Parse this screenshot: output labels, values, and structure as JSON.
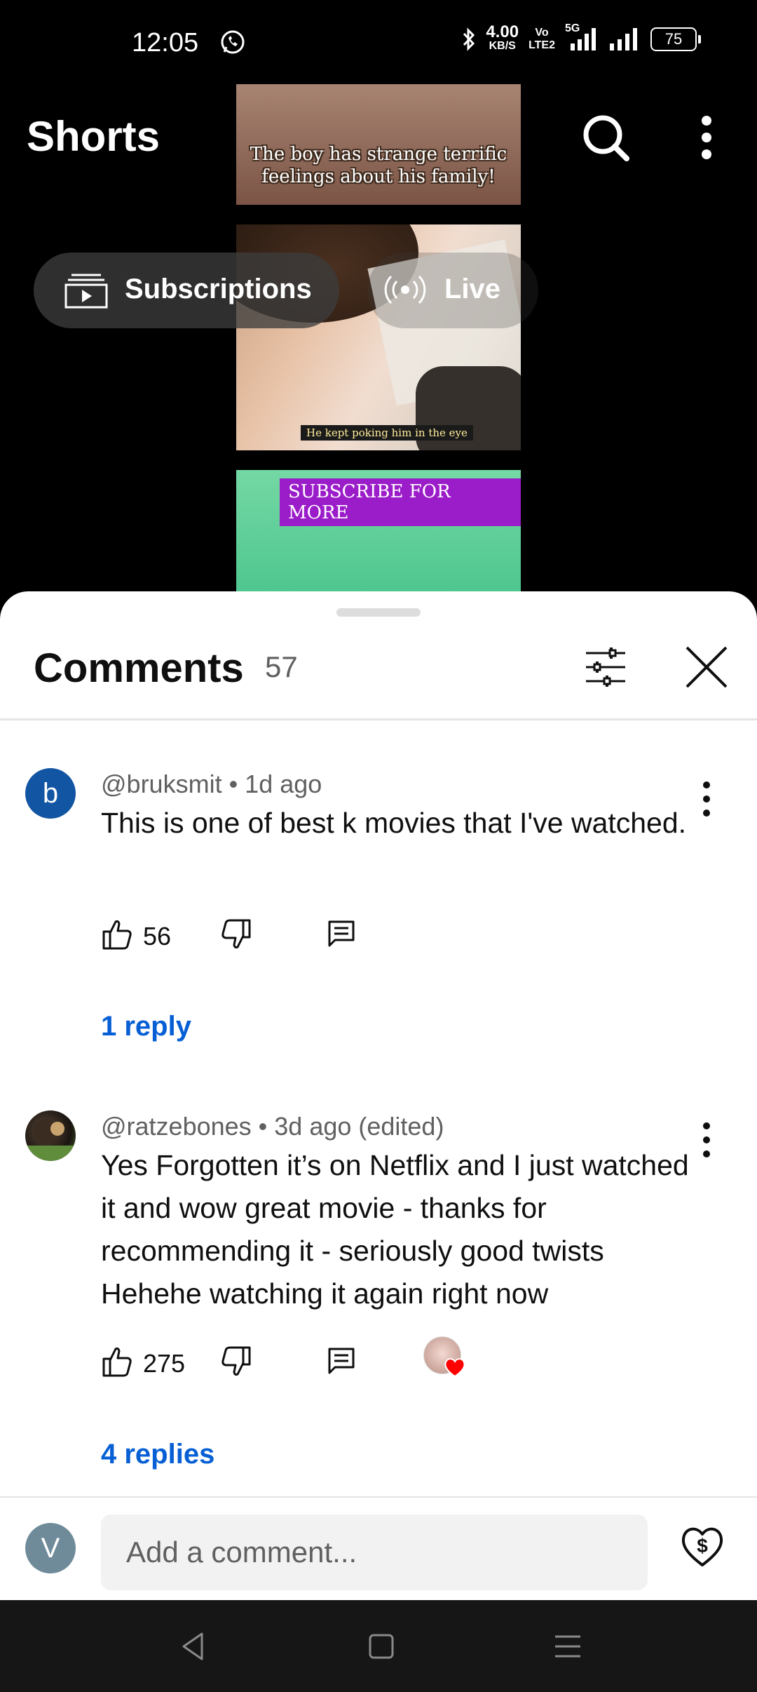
{
  "status_bar": {
    "time": "12:05",
    "net_speed_value": "4.00",
    "net_speed_unit": "KB/S",
    "volte_top": "Vo",
    "volte_bottom": "LTE2",
    "network": "5G",
    "battery": "75"
  },
  "header": {
    "title": "Shorts",
    "chips": [
      {
        "label": "Subscriptions",
        "icon": "subscriptions-icon"
      },
      {
        "label": "Live",
        "icon": "live-icon"
      }
    ]
  },
  "video": {
    "caption_top": "The boy has strange terrific feelings about his family!",
    "caption_mid": "He kept poking him in the eye",
    "caption_bottom": "SUBSCRIBE FOR MORE"
  },
  "comments_panel": {
    "title": "Comments",
    "count": "57",
    "comments": [
      {
        "avatar_letter": "b",
        "author": "@bruksmit",
        "time": "1d ago",
        "meta": "@bruksmit • 1d ago",
        "text": "This is one of best k movies that I've watched.",
        "likes": "56",
        "replies": "1 reply"
      },
      {
        "author": "@ratzebones",
        "time": "3d ago (edited)",
        "meta": "@ratzebones • 3d ago (edited)",
        "text": "Yes Forgotten it’s on Netflix and I just watched it and wow great movie - thanks for recommending it - seriously good twists Hehehe watching it again right now",
        "likes": "275",
        "creator_hearted": true,
        "replies": "4 replies"
      }
    ],
    "compose": {
      "avatar_letter": "V",
      "placeholder": "Add a comment..."
    }
  },
  "colors": {
    "link_blue": "#065fd4",
    "avatar_b": "#1155a3",
    "avatar_v": "#6f8b9a",
    "heart_red": "#ff0000"
  }
}
